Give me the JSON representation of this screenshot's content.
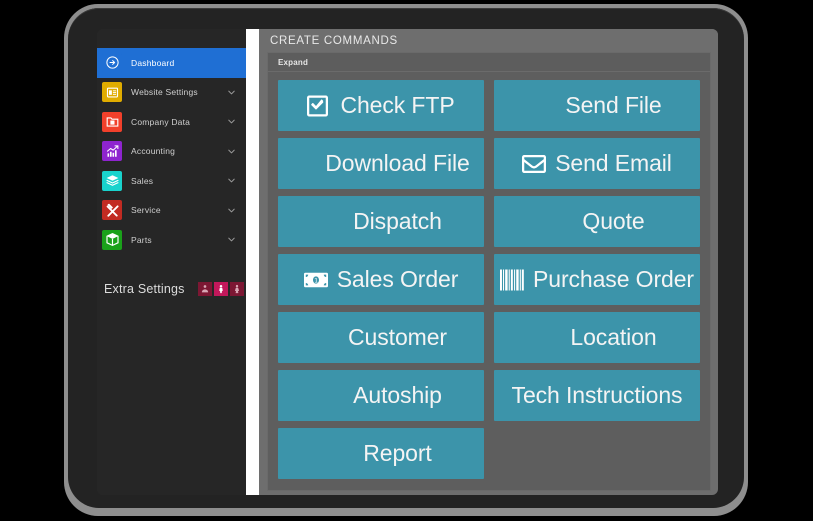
{
  "sidebar": {
    "items": [
      {
        "label": "Dashboard",
        "icon": "arrow-circle-right-icon",
        "color": "#1f6fd4",
        "active": true,
        "chevron": false
      },
      {
        "label": "Website Settings",
        "icon": "window-settings-icon",
        "color": "#e0ac00",
        "active": false,
        "chevron": true
      },
      {
        "label": "Company Data",
        "icon": "folder-document-icon",
        "color": "#f2402b",
        "active": false,
        "chevron": true
      },
      {
        "label": "Accounting",
        "icon": "bar-chart-icon",
        "color": "#8e24cf",
        "active": false,
        "chevron": true
      },
      {
        "label": "Sales",
        "icon": "stacked-books-icon",
        "color": "#19d3cd",
        "active": false,
        "chevron": true
      },
      {
        "label": "Service",
        "icon": "wrench-screwdriver-icon",
        "color": "#c22b22",
        "active": false,
        "chevron": true
      },
      {
        "label": "Parts",
        "icon": "box-icon",
        "color": "#1aa11a",
        "active": false,
        "chevron": true
      }
    ],
    "extra": {
      "label": "Extra Settings",
      "icons": [
        {
          "name": "person-male-icon",
          "active": false
        },
        {
          "name": "person-filled-icon",
          "active": true
        },
        {
          "name": "person-female-icon",
          "active": false
        }
      ]
    }
  },
  "main": {
    "title": "CREATE COMMANDS",
    "expand_label": "Expand",
    "button_color": "#3c94aa",
    "commands": [
      {
        "label": "Check FTP",
        "icon": "check-square-icon"
      },
      {
        "label": "Send File",
        "icon": "arrow-circle-up-icon"
      },
      {
        "label": "Download File",
        "icon": "arrow-circle-down-icon"
      },
      {
        "label": "Send Email",
        "icon": "envelope-icon"
      },
      {
        "label": "Dispatch",
        "icon": "wrench-icon"
      },
      {
        "label": "Quote",
        "icon": "shopping-cart-icon"
      },
      {
        "label": "Sales Order",
        "icon": "money-bill-icon"
      },
      {
        "label": "Purchase Order",
        "icon": "barcode-icon"
      },
      {
        "label": "Customer",
        "icon": "users-icon"
      },
      {
        "label": "Location",
        "icon": "user-icon"
      },
      {
        "label": "Autoship",
        "icon": "refresh-icon"
      },
      {
        "label": "Tech Instructions",
        "icon": "none"
      },
      {
        "label": "Report",
        "icon": "folder-open-icon"
      }
    ]
  }
}
